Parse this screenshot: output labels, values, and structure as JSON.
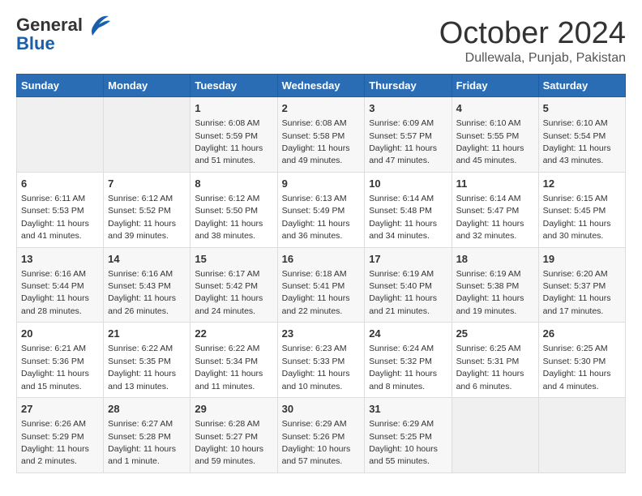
{
  "header": {
    "logo_general": "General",
    "logo_blue": "Blue",
    "title": "October 2024",
    "location": "Dullewala, Punjab, Pakistan"
  },
  "days_of_week": [
    "Sunday",
    "Monday",
    "Tuesday",
    "Wednesday",
    "Thursday",
    "Friday",
    "Saturday"
  ],
  "weeks": [
    [
      {
        "day": "",
        "sunrise": "",
        "sunset": "",
        "daylight": ""
      },
      {
        "day": "",
        "sunrise": "",
        "sunset": "",
        "daylight": ""
      },
      {
        "day": "1",
        "sunrise": "Sunrise: 6:08 AM",
        "sunset": "Sunset: 5:59 PM",
        "daylight": "Daylight: 11 hours and 51 minutes."
      },
      {
        "day": "2",
        "sunrise": "Sunrise: 6:08 AM",
        "sunset": "Sunset: 5:58 PM",
        "daylight": "Daylight: 11 hours and 49 minutes."
      },
      {
        "day": "3",
        "sunrise": "Sunrise: 6:09 AM",
        "sunset": "Sunset: 5:57 PM",
        "daylight": "Daylight: 11 hours and 47 minutes."
      },
      {
        "day": "4",
        "sunrise": "Sunrise: 6:10 AM",
        "sunset": "Sunset: 5:55 PM",
        "daylight": "Daylight: 11 hours and 45 minutes."
      },
      {
        "day": "5",
        "sunrise": "Sunrise: 6:10 AM",
        "sunset": "Sunset: 5:54 PM",
        "daylight": "Daylight: 11 hours and 43 minutes."
      }
    ],
    [
      {
        "day": "6",
        "sunrise": "Sunrise: 6:11 AM",
        "sunset": "Sunset: 5:53 PM",
        "daylight": "Daylight: 11 hours and 41 minutes."
      },
      {
        "day": "7",
        "sunrise": "Sunrise: 6:12 AM",
        "sunset": "Sunset: 5:52 PM",
        "daylight": "Daylight: 11 hours and 39 minutes."
      },
      {
        "day": "8",
        "sunrise": "Sunrise: 6:12 AM",
        "sunset": "Sunset: 5:50 PM",
        "daylight": "Daylight: 11 hours and 38 minutes."
      },
      {
        "day": "9",
        "sunrise": "Sunrise: 6:13 AM",
        "sunset": "Sunset: 5:49 PM",
        "daylight": "Daylight: 11 hours and 36 minutes."
      },
      {
        "day": "10",
        "sunrise": "Sunrise: 6:14 AM",
        "sunset": "Sunset: 5:48 PM",
        "daylight": "Daylight: 11 hours and 34 minutes."
      },
      {
        "day": "11",
        "sunrise": "Sunrise: 6:14 AM",
        "sunset": "Sunset: 5:47 PM",
        "daylight": "Daylight: 11 hours and 32 minutes."
      },
      {
        "day": "12",
        "sunrise": "Sunrise: 6:15 AM",
        "sunset": "Sunset: 5:45 PM",
        "daylight": "Daylight: 11 hours and 30 minutes."
      }
    ],
    [
      {
        "day": "13",
        "sunrise": "Sunrise: 6:16 AM",
        "sunset": "Sunset: 5:44 PM",
        "daylight": "Daylight: 11 hours and 28 minutes."
      },
      {
        "day": "14",
        "sunrise": "Sunrise: 6:16 AM",
        "sunset": "Sunset: 5:43 PM",
        "daylight": "Daylight: 11 hours and 26 minutes."
      },
      {
        "day": "15",
        "sunrise": "Sunrise: 6:17 AM",
        "sunset": "Sunset: 5:42 PM",
        "daylight": "Daylight: 11 hours and 24 minutes."
      },
      {
        "day": "16",
        "sunrise": "Sunrise: 6:18 AM",
        "sunset": "Sunset: 5:41 PM",
        "daylight": "Daylight: 11 hours and 22 minutes."
      },
      {
        "day": "17",
        "sunrise": "Sunrise: 6:19 AM",
        "sunset": "Sunset: 5:40 PM",
        "daylight": "Daylight: 11 hours and 21 minutes."
      },
      {
        "day": "18",
        "sunrise": "Sunrise: 6:19 AM",
        "sunset": "Sunset: 5:38 PM",
        "daylight": "Daylight: 11 hours and 19 minutes."
      },
      {
        "day": "19",
        "sunrise": "Sunrise: 6:20 AM",
        "sunset": "Sunset: 5:37 PM",
        "daylight": "Daylight: 11 hours and 17 minutes."
      }
    ],
    [
      {
        "day": "20",
        "sunrise": "Sunrise: 6:21 AM",
        "sunset": "Sunset: 5:36 PM",
        "daylight": "Daylight: 11 hours and 15 minutes."
      },
      {
        "day": "21",
        "sunrise": "Sunrise: 6:22 AM",
        "sunset": "Sunset: 5:35 PM",
        "daylight": "Daylight: 11 hours and 13 minutes."
      },
      {
        "day": "22",
        "sunrise": "Sunrise: 6:22 AM",
        "sunset": "Sunset: 5:34 PM",
        "daylight": "Daylight: 11 hours and 11 minutes."
      },
      {
        "day": "23",
        "sunrise": "Sunrise: 6:23 AM",
        "sunset": "Sunset: 5:33 PM",
        "daylight": "Daylight: 11 hours and 10 minutes."
      },
      {
        "day": "24",
        "sunrise": "Sunrise: 6:24 AM",
        "sunset": "Sunset: 5:32 PM",
        "daylight": "Daylight: 11 hours and 8 minutes."
      },
      {
        "day": "25",
        "sunrise": "Sunrise: 6:25 AM",
        "sunset": "Sunset: 5:31 PM",
        "daylight": "Daylight: 11 hours and 6 minutes."
      },
      {
        "day": "26",
        "sunrise": "Sunrise: 6:25 AM",
        "sunset": "Sunset: 5:30 PM",
        "daylight": "Daylight: 11 hours and 4 minutes."
      }
    ],
    [
      {
        "day": "27",
        "sunrise": "Sunrise: 6:26 AM",
        "sunset": "Sunset: 5:29 PM",
        "daylight": "Daylight: 11 hours and 2 minutes."
      },
      {
        "day": "28",
        "sunrise": "Sunrise: 6:27 AM",
        "sunset": "Sunset: 5:28 PM",
        "daylight": "Daylight: 11 hours and 1 minute."
      },
      {
        "day": "29",
        "sunrise": "Sunrise: 6:28 AM",
        "sunset": "Sunset: 5:27 PM",
        "daylight": "Daylight: 10 hours and 59 minutes."
      },
      {
        "day": "30",
        "sunrise": "Sunrise: 6:29 AM",
        "sunset": "Sunset: 5:26 PM",
        "daylight": "Daylight: 10 hours and 57 minutes."
      },
      {
        "day": "31",
        "sunrise": "Sunrise: 6:29 AM",
        "sunset": "Sunset: 5:25 PM",
        "daylight": "Daylight: 10 hours and 55 minutes."
      },
      {
        "day": "",
        "sunrise": "",
        "sunset": "",
        "daylight": ""
      },
      {
        "day": "",
        "sunrise": "",
        "sunset": "",
        "daylight": ""
      }
    ]
  ]
}
